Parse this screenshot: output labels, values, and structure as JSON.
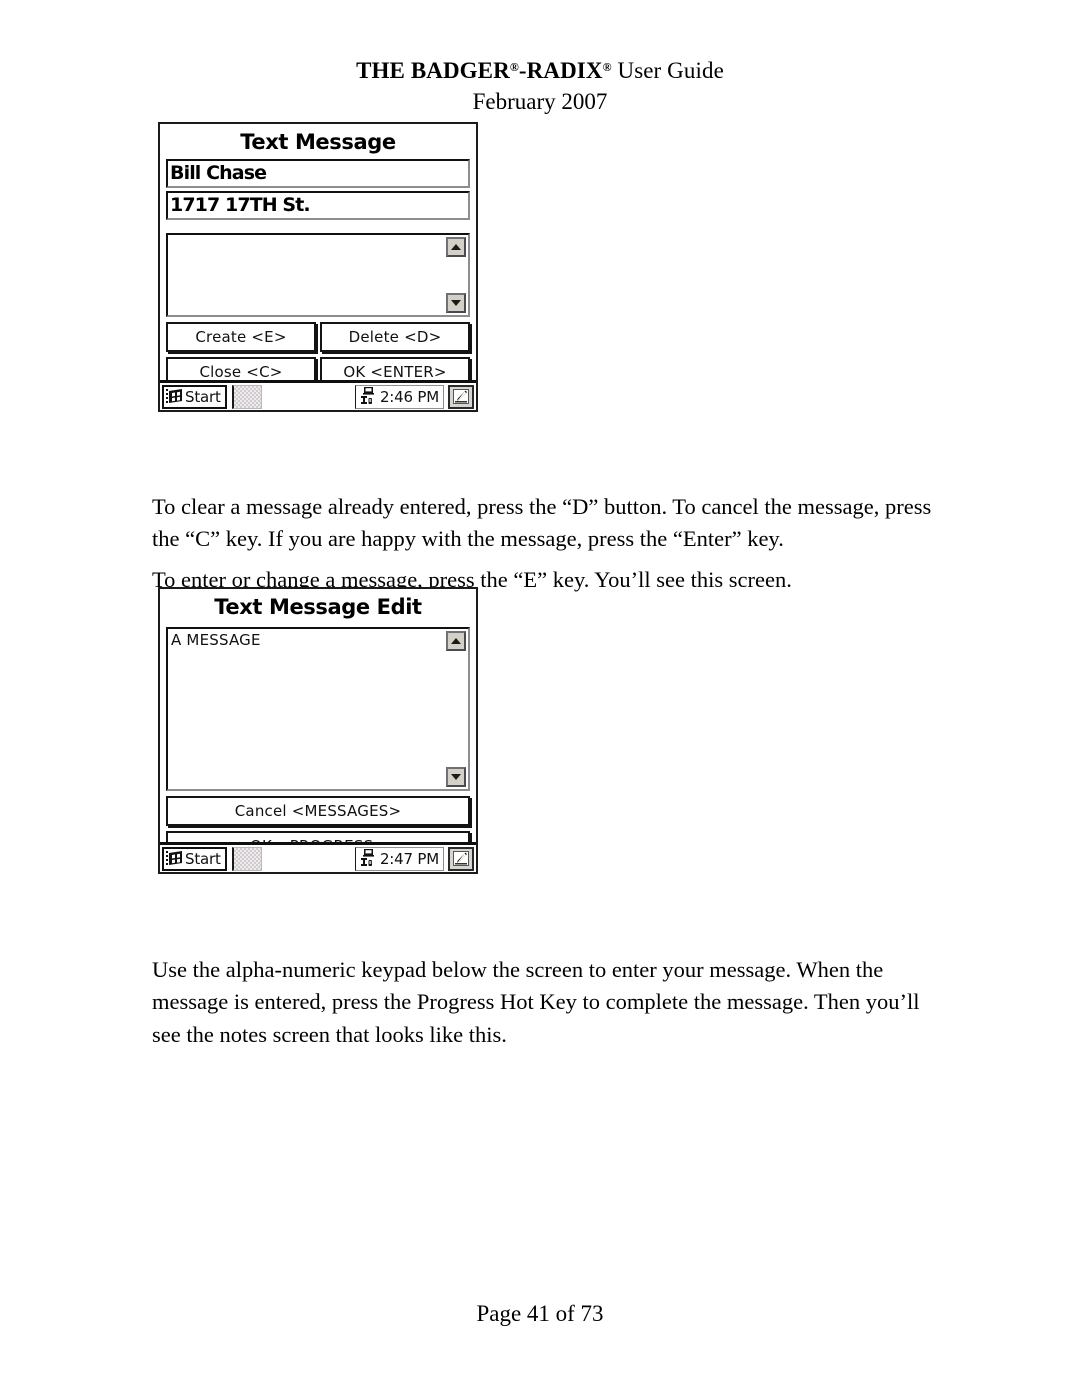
{
  "header": {
    "title_pre": "THE BADGER",
    "reg_mark": "®",
    "title_mid": "-RADIX",
    "title_post": " User Guide",
    "date": "February 2007"
  },
  "paragraphs": {
    "p1": "To clear a message already entered, press the “D” button.  To cancel the message, press the “C” key.  If you are happy with the message, press the “Enter” key.",
    "p2": "To enter or change a message, press the “E” key.  You’ll see this screen.",
    "p3": "Use the alpha-numeric keypad below the screen to enter your message.  When the message is entered, press the Progress Hot Key to complete the message.  Then you’ll see the notes screen that looks like this."
  },
  "footer": {
    "page_label": "Page 41 of 73"
  },
  "screenshot_1": {
    "title": "Text Message",
    "field_name": "Bill Chase",
    "field_address": "1717 17TH St.",
    "memo_value": "",
    "buttons": [
      {
        "label": "Create <E>"
      },
      {
        "label": "Delete <D>"
      },
      {
        "label": "Close <C>"
      },
      {
        "label": "OK <ENTER>"
      }
    ],
    "taskbar": {
      "start_label": "Start",
      "clock": "2:46 PM"
    }
  },
  "screenshot_2": {
    "title": "Text Message Edit",
    "memo_value": "A MESSAGE",
    "buttons": [
      {
        "label": "Cancel <MESSAGES>"
      },
      {
        "label": "OK <PROGRESS>"
      }
    ],
    "taskbar": {
      "start_label": "Start",
      "clock": "2:47 PM"
    }
  },
  "colors": {
    "page_bg": "#ffffff",
    "ink": "#000000",
    "chrome_gray": "#d4d0c8",
    "tray_dither": "#cfcbcf"
  }
}
